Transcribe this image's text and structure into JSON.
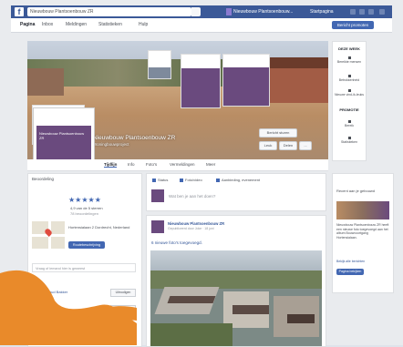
{
  "topbar": {
    "logo": "f",
    "search_value": "Nieuwbouw Plantsoenbouw ZR",
    "user_name": "Nieuwbouw Plantsoenbouw...",
    "home_label": "Startpagina"
  },
  "admin_tabs": [
    {
      "label": "Pagina"
    },
    {
      "label": "Inbox"
    },
    {
      "label": "Meldingen"
    },
    {
      "label": "Statistieken"
    },
    {
      "label": "Hulp"
    }
  ],
  "promote_label": "Bericht promoten",
  "cover": {
    "title": "Nieuwbouw Plantsoenbouw ZR",
    "subtitle": "Woningbouwproject",
    "buttons": [
      "Bericht sturen",
      "Leuk",
      "Delen",
      "..."
    ]
  },
  "profile_text": "Nieuwbouw Plantsoenbouw ZR",
  "right_panel": {
    "head1": "DEZE WEEK",
    "items1": [
      "Bereikte mensen",
      "Betrokkenheid",
      "Nieuwe vind-ik-leuks"
    ],
    "head2": "PROMOTIE",
    "items2": [
      "Bereik",
      "Statistieken"
    ]
  },
  "page_tabs": [
    "Tijdlijn",
    "Info",
    "Foto's",
    "Vermeldingen",
    "Meer"
  ],
  "left_col": {
    "head": "Beoordeling",
    "stars": "★★★★★",
    "rating": "4,9 van de 5 sterren",
    "count": "78 beoordelingen",
    "address": "Hortensialaan 2 Dordrecht, Nederland",
    "address_button": "Routebeschrijving",
    "input_placeholder": "Vraag of iemand hier is geweest",
    "people": [
      {
        "name": "Ruud Bakker",
        "button": "Uitnodigen"
      },
      {
        "name": "Joke Beilen",
        "button": "Uitnodigen"
      }
    ]
  },
  "composer": {
    "tabs": [
      "Status",
      "Foto/video",
      "Aanbieding, evenement"
    ],
    "placeholder": "Wat ben je aan het doen?"
  },
  "post": {
    "name": "Nieuwbouw Plantsoenbouw ZR",
    "time": "Gepubliceerd door Joke · 18 juni",
    "text": "6 nieuwe foto's toegevoegd."
  },
  "right_sidebar": {
    "head": "Recent aan je gebouwd",
    "text": "Nieuwbouw Plantsoenbouw ZR heeft een nieuwe foto toegevoegd aan het album Bouwvoortgang Hortensialaan.",
    "link": "Bekijk alle berichten",
    "button": "Pagina bekijken"
  },
  "colors": {
    "brand": "#3b5998",
    "accent": "#4267b2",
    "overlay": "#e98a2a"
  }
}
